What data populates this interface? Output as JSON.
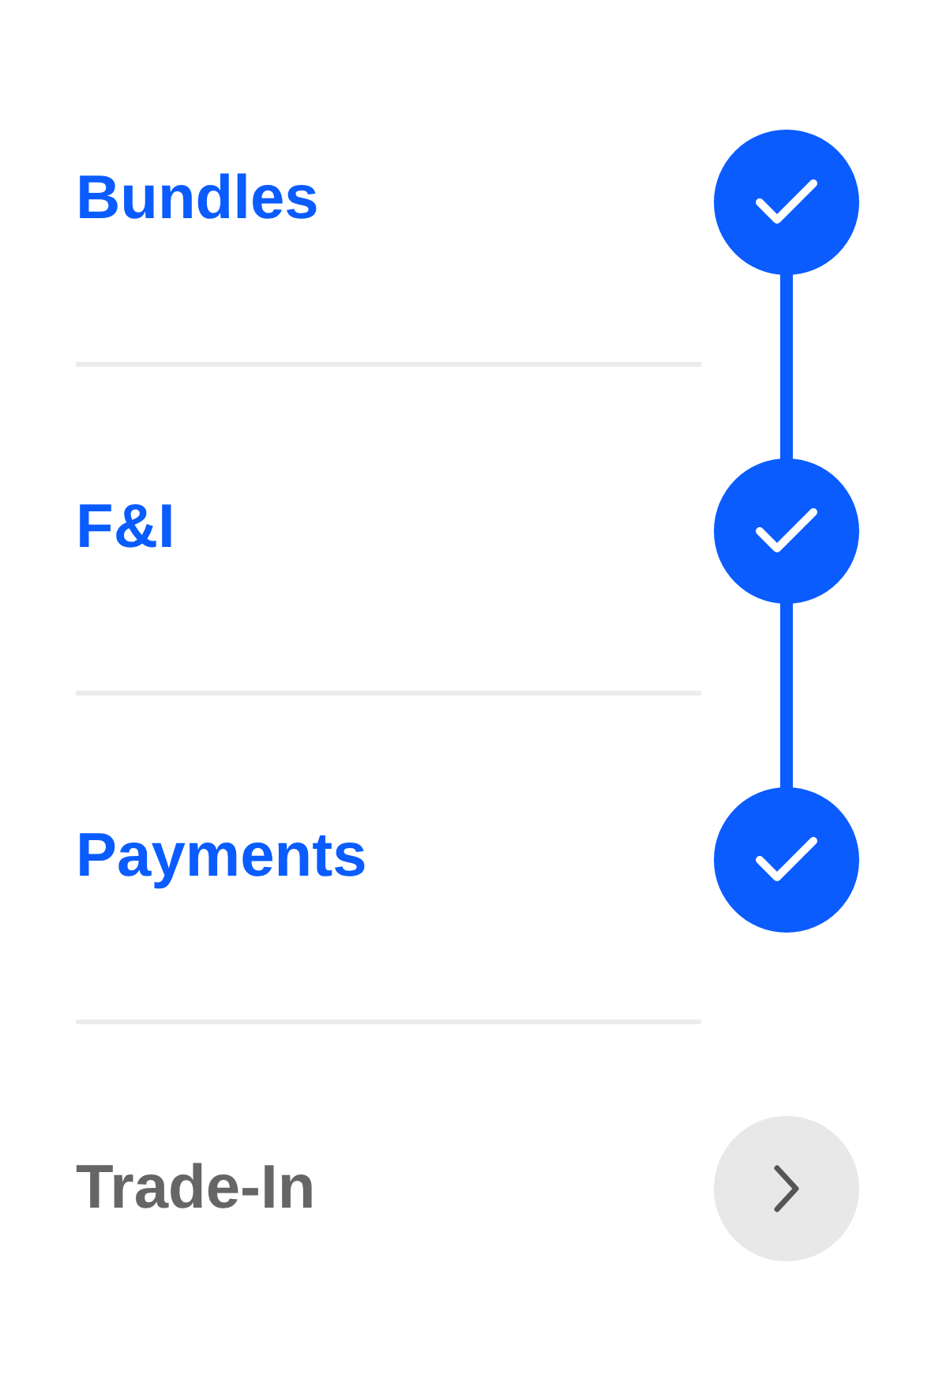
{
  "steps": [
    {
      "label": "Bundles",
      "completed": true
    },
    {
      "label": "F&I",
      "completed": true
    },
    {
      "label": "Payments",
      "completed": true
    },
    {
      "label": "Trade-In",
      "completed": false
    }
  ]
}
